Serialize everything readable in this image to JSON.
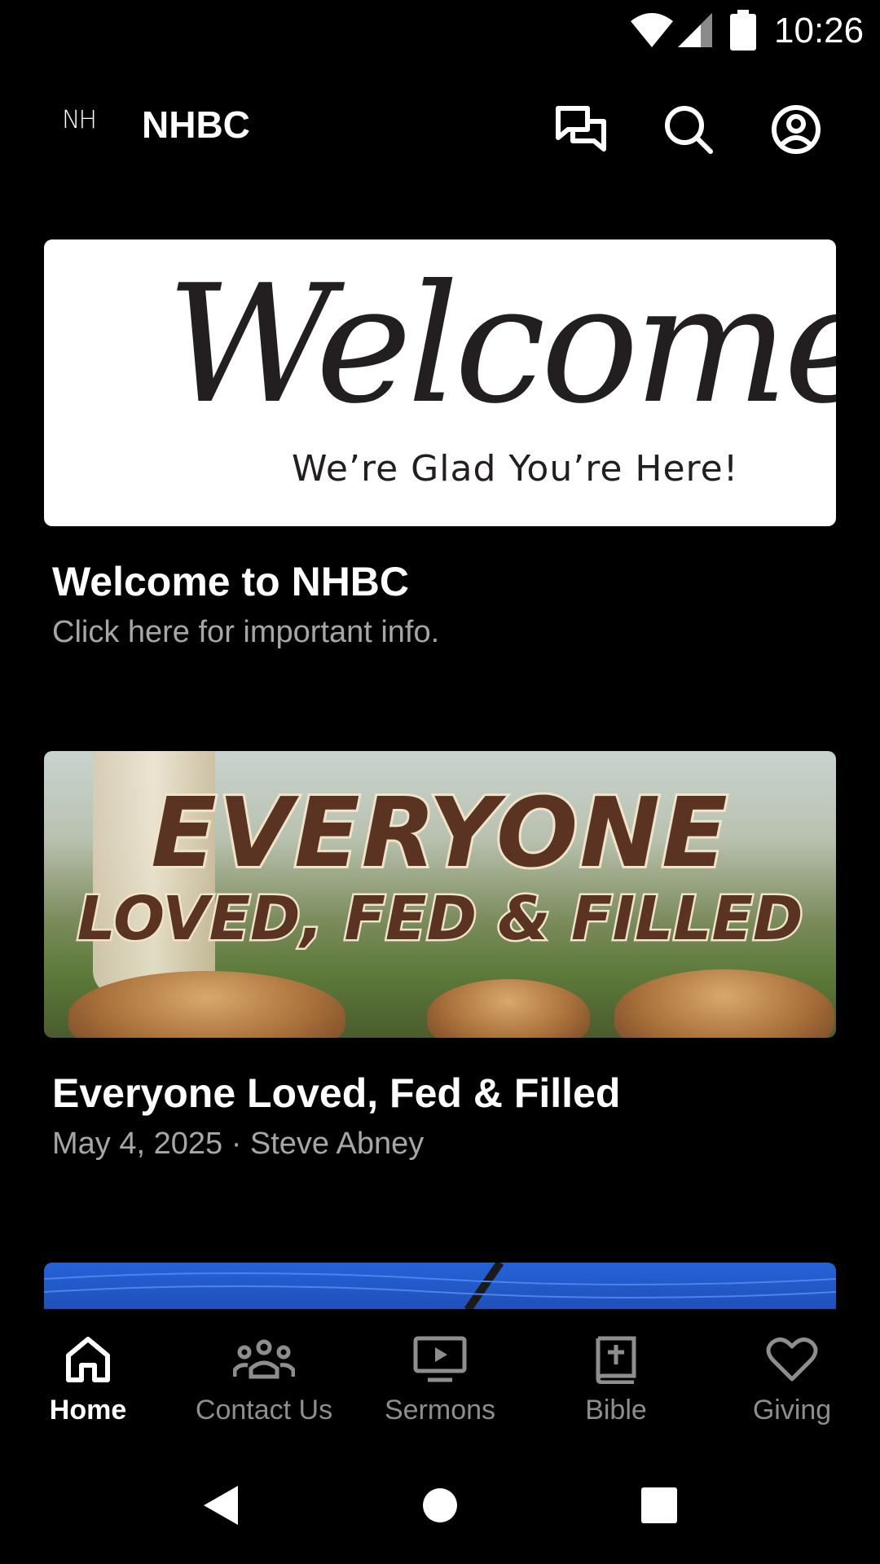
{
  "status_bar": {
    "time": "10:26",
    "icons": [
      "wifi-icon",
      "signal-icon",
      "battery-icon"
    ]
  },
  "app_bar": {
    "logo": "NH",
    "title": "NHBC",
    "actions": [
      "chat-icon",
      "search-icon",
      "account-icon"
    ]
  },
  "feed": {
    "cards": [
      {
        "image_text": {
          "script": "Welcome",
          "tagline": "We’re Glad You’re Here!"
        },
        "title": "Welcome to NHBC",
        "subtitle": "Click here for important info."
      },
      {
        "image_text": {
          "line1": "EVERYONE",
          "line2": "LOVED, FED & FILLED"
        },
        "title": "Everyone Loved, Fed & Filled",
        "subtitle": "May 4, 2025 · Steve Abney"
      },
      {
        "image_text": {},
        "title": "",
        "subtitle": ""
      }
    ]
  },
  "bottom_nav": {
    "items": [
      {
        "label": "Home",
        "icon": "home-icon",
        "active": true
      },
      {
        "label": "Contact Us",
        "icon": "people-icon",
        "active": false
      },
      {
        "label": "Sermons",
        "icon": "tv-play-icon",
        "active": false
      },
      {
        "label": "Bible",
        "icon": "bible-icon",
        "active": false
      },
      {
        "label": "Giving",
        "icon": "heart-icon",
        "active": false
      }
    ]
  },
  "system_nav": {
    "buttons": [
      "back-icon",
      "home-circle-icon",
      "recents-icon"
    ]
  },
  "colors": {
    "background": "#000000",
    "text_primary": "#ffffff",
    "text_secondary": "#a6a6a6",
    "nav_inactive": "#8e8e8e",
    "sermon_text": "#5a3322",
    "blue_card": "#2563d8"
  }
}
